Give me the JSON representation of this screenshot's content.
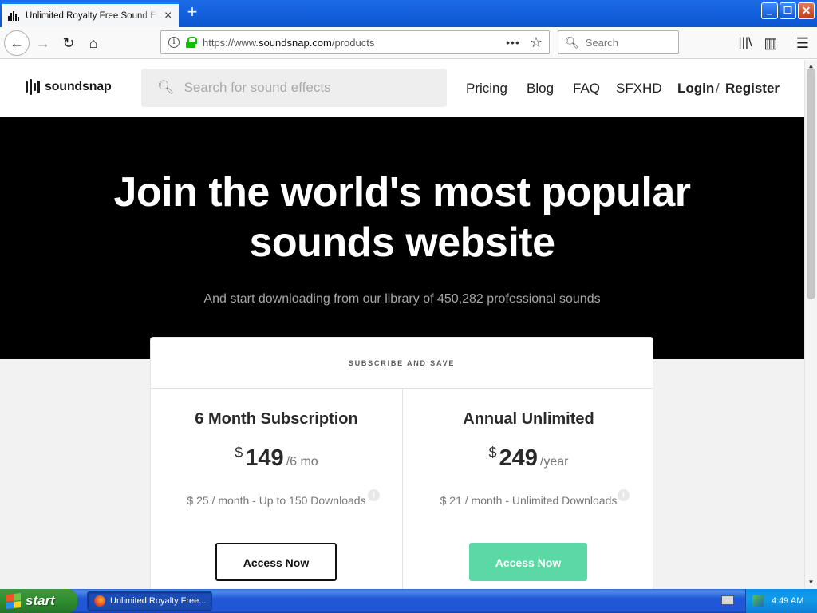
{
  "browser": {
    "tab_title": "Unlimited Royalty Free Sound Effe",
    "tab_close": "×",
    "new_tab": "+",
    "url_prefix": "https://www.",
    "url_host": "soundsnap.com",
    "url_path": "/products",
    "search_placeholder": "Search",
    "page_actions": "•••",
    "window_buttons": {
      "minimize": "_",
      "restore": "❐",
      "close": "✕"
    }
  },
  "site": {
    "logo_text": "soundsnap",
    "search_placeholder": "Search for sound effects",
    "nav": {
      "pricing": "Pricing",
      "blog": "Blog",
      "faq": "FAQ",
      "sfxhd": "SFXHD",
      "login": "Login",
      "slash": "/",
      "register": "Register"
    }
  },
  "hero": {
    "title_line1": "Join the world's most popular",
    "title_line2": "sounds website",
    "subtitle": "And start downloading from our library of 450,282 professional sounds"
  },
  "pricing": {
    "header": "SUBSCRIBE AND SAVE",
    "plans": [
      {
        "name": "6 Month Subscription",
        "currency": "$",
        "amount": "149",
        "period": "/6 mo",
        "note": "$ 25 / month - Up to 150 Downloads",
        "info": "i",
        "button": "Access Now"
      },
      {
        "name": "Annual Unlimited",
        "currency": "$",
        "amount": "249",
        "period": "/year",
        "note": "$ 21 / month - Unlimited Downloads",
        "info": "i",
        "button": "Access Now"
      }
    ],
    "colors": {
      "accent_button": "#5ad9a4"
    }
  },
  "taskbar": {
    "start_label": "start",
    "task_label": "Unlimited Royalty Free...",
    "clock": "4:49 AM"
  },
  "icons": {
    "back": "back-arrow-icon",
    "forward": "forward-arrow-icon",
    "reload": "reload-icon",
    "home": "home-icon",
    "info": "info-icon",
    "lock": "lock-icon",
    "star": "bookmark-star-icon",
    "search": "search-icon",
    "library": "library-icon",
    "sidebar": "sidebar-icon",
    "menu": "hamburger-menu-icon"
  }
}
